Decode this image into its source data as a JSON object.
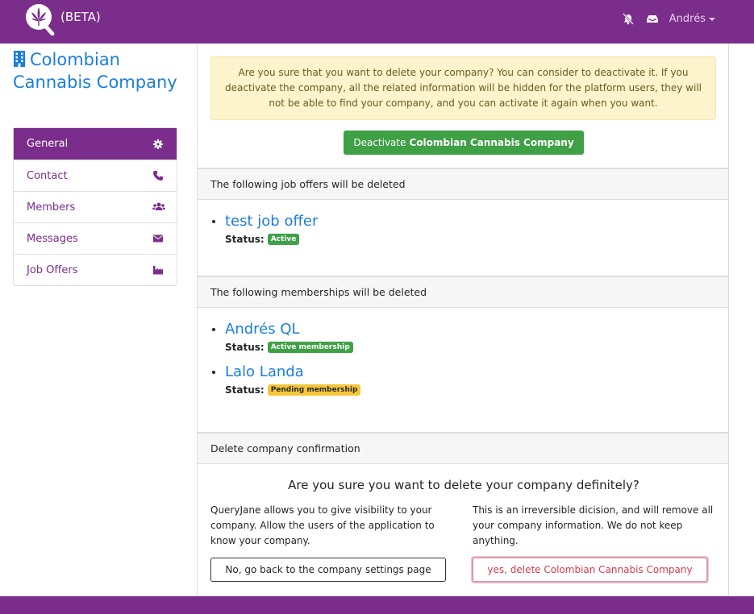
{
  "navbar": {
    "beta_label": "(BETA)",
    "user_label": "Andrés",
    "icons": [
      "logo-icon",
      "bell-slash-icon",
      "inbox-icon",
      "chevron-down-icon"
    ],
    "color": "#7b2d8b"
  },
  "sidebar": {
    "company_name": "Colombian Cannabis Company",
    "items": [
      {
        "label": "General",
        "icon": "gear-icon",
        "active": true
      },
      {
        "label": "Contact",
        "icon": "phone-icon",
        "active": false
      },
      {
        "label": "Members",
        "icon": "users-icon",
        "active": false
      },
      {
        "label": "Messages",
        "icon": "envelope-icon",
        "active": false
      },
      {
        "label": "Job Offers",
        "icon": "factory-icon",
        "active": false
      }
    ]
  },
  "warning": {
    "text": "Are you sure that you want to delete your company? You can consider to deactivate it. If you deactivate the company, all the related information will be hidden for the platform users, they will not be able to find your company, and you can activate it again when you want.",
    "deactivate_prefix": "Deactivate",
    "deactivate_company": "Colombian Cannabis Company"
  },
  "job_offers": {
    "header": "The following job offers will be deleted",
    "items": [
      {
        "title": "test job offer",
        "status_label": "Status:",
        "status": "Active",
        "status_color": "#3fa046"
      }
    ]
  },
  "memberships": {
    "header": "The following memberships will be deleted",
    "items": [
      {
        "title": "Andrés QL",
        "status_label": "Status:",
        "status": "Active membership",
        "status_color": "#3fa046"
      },
      {
        "title": "Lalo Landa",
        "status_label": "Status:",
        "status": "Pending membership",
        "status_color": "#f4c63a"
      }
    ]
  },
  "confirmation": {
    "header": "Delete company confirmation",
    "question": "Are you sure you want to delete your company definitely?",
    "left_text": "QueryJane allows you to give visibility to your company. Allow the users of the application to know your company.",
    "right_text": "This is an irreversible dicision, and will remove all your company information. We do not keep anything.",
    "back_button": "No, go back to the company settings page",
    "delete_button": "yes, delete Colombian Cannabis Company"
  }
}
